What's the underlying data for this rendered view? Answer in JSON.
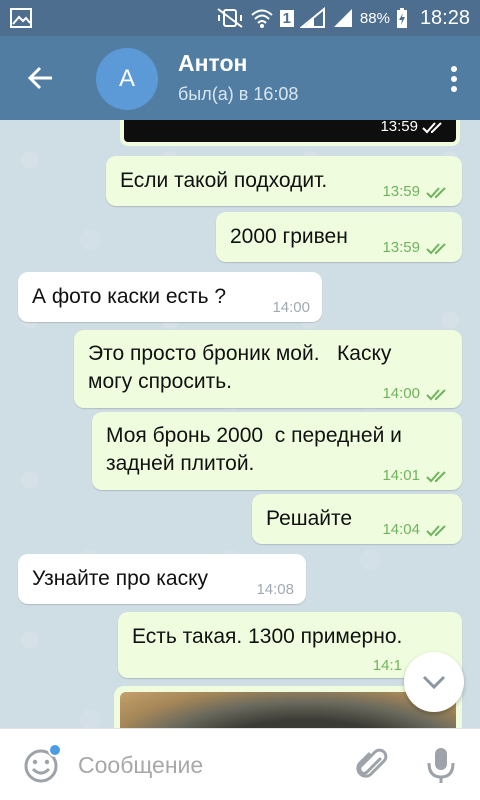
{
  "status_bar": {
    "battery": "88%",
    "sim": "1",
    "time": "18:28"
  },
  "header": {
    "avatar_letter": "A",
    "title": "Антон",
    "subtitle": "был(а) в 16:08"
  },
  "photo_top": {
    "time": "13:59"
  },
  "messages": [
    {
      "dir": "out",
      "text": "Если такой подходит.",
      "time": "13:59",
      "read": true
    },
    {
      "dir": "out",
      "text": "2000 гривен",
      "time": "13:59",
      "read": true
    },
    {
      "dir": "in",
      "text": "А фото каски есть ?",
      "time": "14:00"
    },
    {
      "dir": "out",
      "line1": "Это просто броник мой.   Каску",
      "line2": "могу спросить.",
      "time": "14:00",
      "read": true
    },
    {
      "dir": "out",
      "line1": "Моя бронь 2000  с передней и",
      "line2": "задней плитой.",
      "time": "14:01",
      "read": true
    },
    {
      "dir": "out",
      "text": "Решайте",
      "time": "14:04",
      "read": true
    },
    {
      "dir": "in",
      "text": "Узнайте про каску",
      "time": "14:08"
    },
    {
      "dir": "out",
      "text": "Есть такая.  1300 примерно.",
      "time": "14:1"
    }
  ],
  "input": {
    "placeholder": "Сообщение"
  },
  "colors": {
    "header": "#527da3",
    "status_bar": "#4d6e8f",
    "outgoing_bubble": "#effdde",
    "incoming_bubble": "#ffffff",
    "chat_background": "#cfdde4",
    "read_ticks": "#6fb35e"
  },
  "icons": {
    "back": "arrow-left-icon",
    "menu": "more-vertical-icon",
    "emoji": "smiley-icon",
    "attach": "paperclip-icon",
    "mic": "microphone-icon",
    "scroll_down": "chevron-down-icon"
  }
}
